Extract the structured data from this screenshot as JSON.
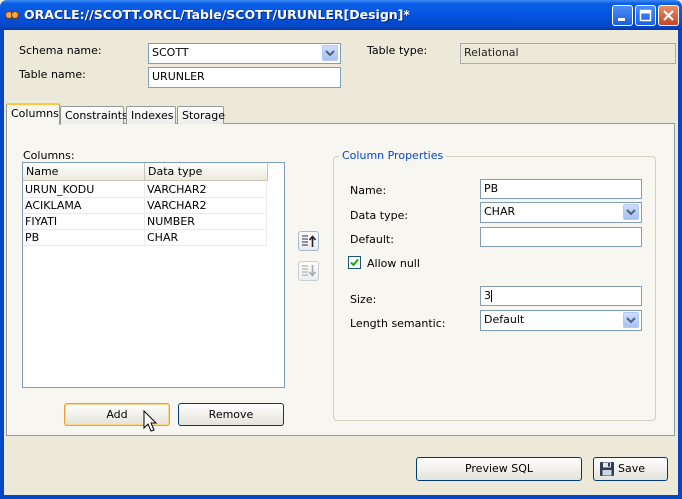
{
  "window": {
    "title": "ORACLE://SCOTT.ORCL/Table/SCOTT/URUNLER[Design]*"
  },
  "header": {
    "schema_label": "Schema name:",
    "schema_value": "SCOTT",
    "table_label": "Table name:",
    "table_value": "URUNLER",
    "type_label": "Table type:",
    "type_value": "Relational"
  },
  "tabs": [
    "Columns",
    "Constraints",
    "Indexes",
    "Storage"
  ],
  "active_tab": "Columns",
  "columns_panel": {
    "label": "Columns:",
    "headers": [
      "Name",
      "Data type"
    ],
    "rows": [
      [
        "URUN_KODU",
        "VARCHAR2"
      ],
      [
        "ACIKLAMA",
        "VARCHAR2"
      ],
      [
        "FIYATI",
        "NUMBER"
      ],
      [
        "PB",
        "CHAR"
      ]
    ],
    "add_label": "Add",
    "remove_label": "Remove"
  },
  "properties": {
    "title": "Column Properties",
    "name_label": "Name:",
    "name_value": "PB",
    "datatype_label": "Data type:",
    "datatype_value": "CHAR",
    "default_label": "Default:",
    "default_value": "",
    "allownull_label": "Allow null",
    "allownull_checked": true,
    "size_label": "Size:",
    "size_value": "3",
    "length_label": "Length semantic:",
    "length_value": "Default"
  },
  "footer": {
    "preview_label": "Preview SQL",
    "save_label": "Save"
  },
  "icons": {
    "app": "oracle-app-icon",
    "move_up": "move-up-icon",
    "move_down": "move-down-icon",
    "save": "floppy-disk-icon"
  },
  "colors": {
    "titlebar": "#0554e0",
    "group_title": "#0046d5",
    "tab_accent": "#ffc73c"
  }
}
